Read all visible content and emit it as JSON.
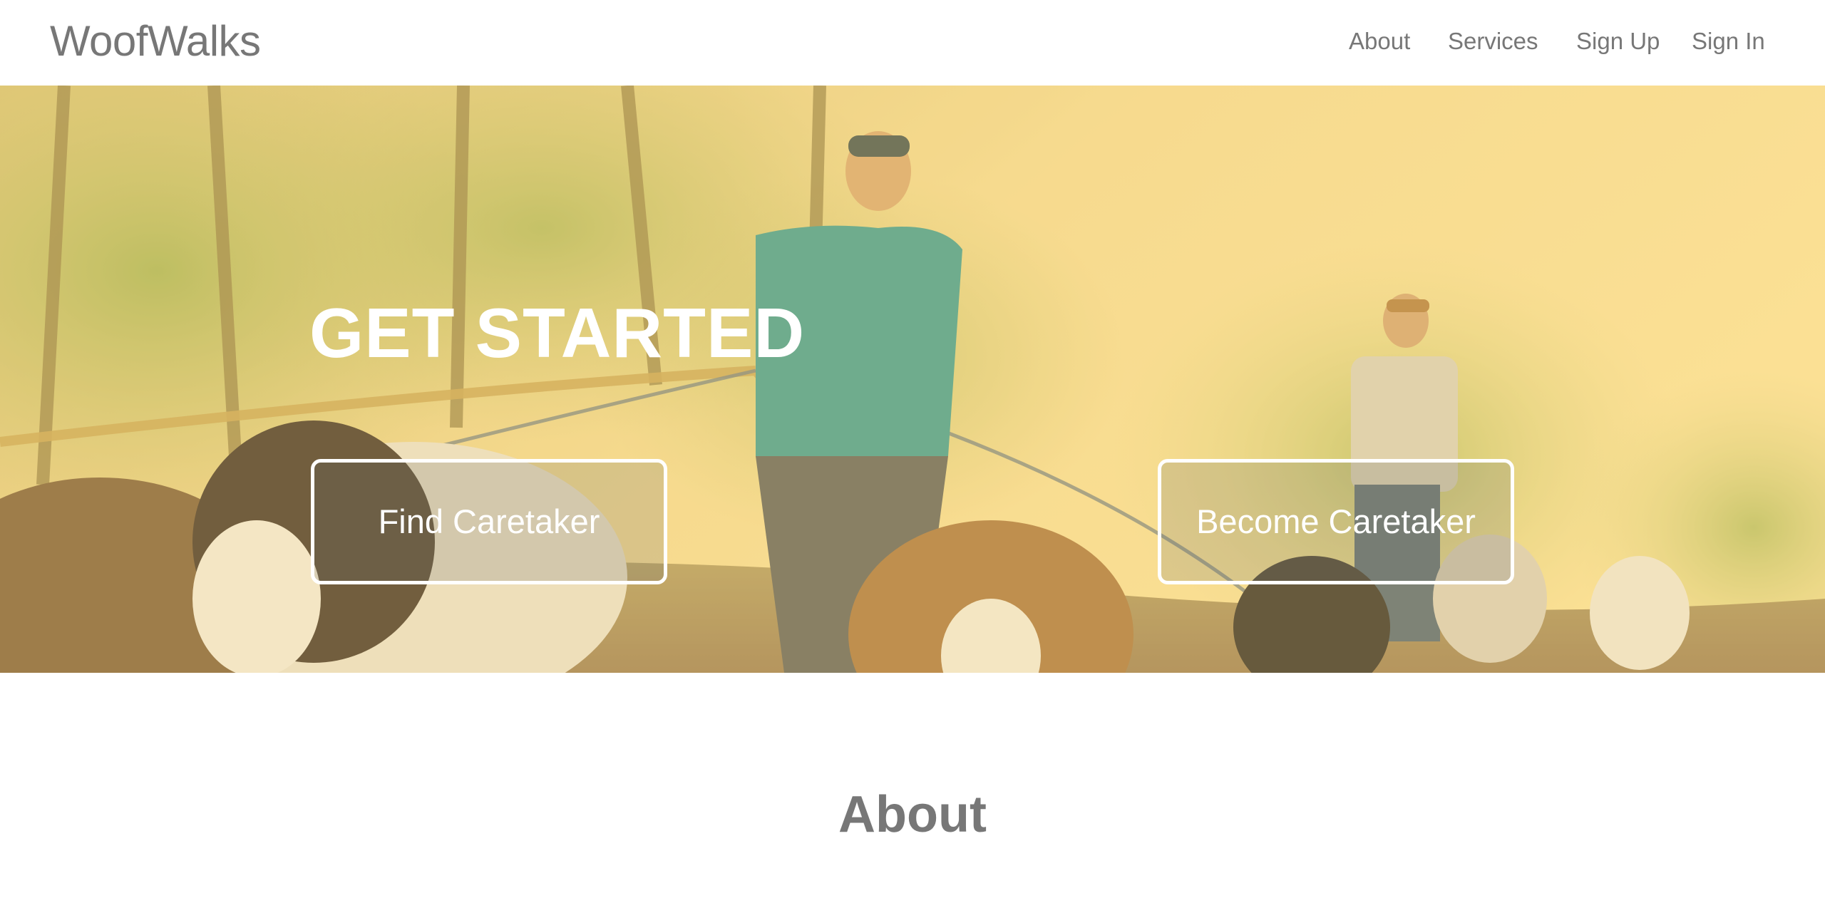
{
  "navbar": {
    "brand": "WoofWalks",
    "links": [
      {
        "label": "About"
      },
      {
        "label": "Services"
      },
      {
        "label": "Sign Up"
      },
      {
        "label": "Sign In"
      }
    ]
  },
  "hero": {
    "title": "GET STARTED",
    "buttons": [
      {
        "label": "Find Caretaker"
      },
      {
        "label": "Become Caretaker"
      }
    ],
    "image": "hero photo: walkers leading dogs on leashes along a wooded trail",
    "overlay_color": "#fad678"
  },
  "about": {
    "heading": "About"
  },
  "colors": {
    "nav_text": "#777777",
    "hero_text": "#ffffff",
    "heading_text": "#777777"
  }
}
